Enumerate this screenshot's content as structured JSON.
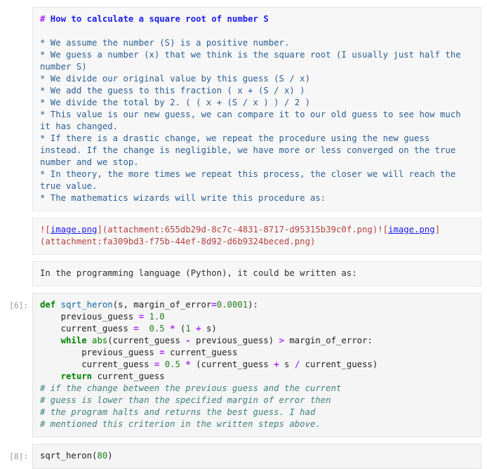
{
  "notebook": {
    "cells": [
      {
        "type": "markdown-source",
        "prompt": "",
        "heading_hash": "#",
        "heading_text": " How to calculate a square root of number S",
        "blank": "",
        "lines": [
          "* We assume the number (S) is a positive number.",
          "* We guess a number (x) that we think is the square root (I usually just half the number S)",
          "* We divide our original value by this guess (S / x)",
          "* We add the guess to this fraction ( x + (S / x) )",
          "* We divide the total by 2. ( ( x + (S / x ) ) / 2 )",
          "* This value is our new guess, we can compare it to our old guess to see how much it has changed.",
          "* If there is a drastic change, we repeat the procedure using the new guess instead. If the change is negligible, we have more or less converged on the true number and we stop.",
          "* In theory, the more times we repeat this process, the closer we will reach the true value.",
          "* The mathematics wizards will write this procedure as:"
        ]
      },
      {
        "type": "markdown-image-links",
        "prompt": "",
        "bang1": "!",
        "lb1": "[",
        "link1": "image.png",
        "rb1": "]",
        "target1": "(attachment:655db29d-8c7c-4831-8717-d95315b39c0f.png)",
        "bang2": "!",
        "lb2": "[",
        "link2": "image.png",
        "rb2": "]",
        "target2": "(attachment:fa309bd3-f75b-44ef-8d92-d6b9324beced.png)"
      },
      {
        "type": "markdown-text",
        "prompt": "",
        "text": "In the programming language (Python), it could be written as:"
      },
      {
        "type": "code",
        "prompt": "[6]:",
        "code_lines": [
          {
            "indent": "",
            "tokens": [
              {
                "t": "def ",
                "c": "kw"
              },
              {
                "t": "sqrt_heron",
                "c": "fn"
              },
              {
                "t": "(s, margin_of_error",
                "c": "code"
              },
              {
                "t": "=",
                "c": "op"
              },
              {
                "t": "0.0001",
                "c": "num"
              },
              {
                "t": "):",
                "c": "code"
              }
            ]
          },
          {
            "indent": "    ",
            "tokens": [
              {
                "t": "previous_guess ",
                "c": "code"
              },
              {
                "t": "=",
                "c": "op"
              },
              {
                "t": " ",
                "c": "code"
              },
              {
                "t": "1.0",
                "c": "num"
              }
            ]
          },
          {
            "indent": "    ",
            "tokens": [
              {
                "t": "current_guess ",
                "c": "code"
              },
              {
                "t": "=",
                "c": "op"
              },
              {
                "t": "  ",
                "c": "code"
              },
              {
                "t": "0.5",
                "c": "num"
              },
              {
                "t": " ",
                "c": "code"
              },
              {
                "t": "*",
                "c": "op"
              },
              {
                "t": " (",
                "c": "code"
              },
              {
                "t": "1",
                "c": "num"
              },
              {
                "t": " ",
                "c": "code"
              },
              {
                "t": "+",
                "c": "op"
              },
              {
                "t": " s)",
                "c": "code"
              }
            ]
          },
          {
            "indent": "    ",
            "tokens": [
              {
                "t": "while ",
                "c": "kw"
              },
              {
                "t": "abs",
                "c": "builtin"
              },
              {
                "t": "(current_guess ",
                "c": "code"
              },
              {
                "t": "-",
                "c": "op"
              },
              {
                "t": " previous_guess) ",
                "c": "code"
              },
              {
                "t": ">",
                "c": "op"
              },
              {
                "t": " margin_of_error:",
                "c": "code"
              }
            ]
          },
          {
            "indent": "        ",
            "tokens": [
              {
                "t": "previous_guess ",
                "c": "code"
              },
              {
                "t": "=",
                "c": "op"
              },
              {
                "t": " current_guess",
                "c": "code"
              }
            ]
          },
          {
            "indent": "        ",
            "tokens": [
              {
                "t": "current_guess ",
                "c": "code"
              },
              {
                "t": "=",
                "c": "op"
              },
              {
                "t": " ",
                "c": "code"
              },
              {
                "t": "0.5",
                "c": "num"
              },
              {
                "t": " ",
                "c": "code"
              },
              {
                "t": "*",
                "c": "op"
              },
              {
                "t": " (current_guess ",
                "c": "code"
              },
              {
                "t": "+",
                "c": "op"
              },
              {
                "t": " s ",
                "c": "code"
              },
              {
                "t": "/",
                "c": "op"
              },
              {
                "t": " current_guess)",
                "c": "code"
              }
            ]
          },
          {
            "indent": "    ",
            "tokens": [
              {
                "t": "return ",
                "c": "kw"
              },
              {
                "t": "current_guess",
                "c": "code"
              }
            ]
          },
          {
            "indent": "",
            "tokens": [
              {
                "t": "# if the change between the previous guess and the current",
                "c": "cmt"
              }
            ]
          },
          {
            "indent": "",
            "tokens": [
              {
                "t": "# guess is lower than the specified margin of error then",
                "c": "cmt"
              }
            ]
          },
          {
            "indent": "",
            "tokens": [
              {
                "t": "# the program halts and returns the best guess. I had",
                "c": "cmt"
              }
            ]
          },
          {
            "indent": "",
            "tokens": [
              {
                "t": "# mentioned this criterion in the written steps above.",
                "c": "cmt"
              }
            ]
          }
        ]
      },
      {
        "type": "code",
        "prompt": "[8]:",
        "code_lines": [
          {
            "indent": "",
            "tokens": [
              {
                "t": "sqrt_heron",
                "c": "code"
              },
              {
                "t": "(",
                "c": "code"
              },
              {
                "t": "80",
                "c": "num"
              },
              {
                "t": ")",
                "c": "code"
              }
            ]
          }
        ]
      }
    ]
  },
  "colors": {
    "cell_background": "#f5f5f5",
    "cell_border": "#e3e3e3",
    "prompt_text": "#9a9a9a",
    "markdown_source": "#2b5f93",
    "heading": "#1a1aee",
    "heading_hash": "#aa22ff",
    "link": "#1a1aee",
    "link_target": "#b5413f",
    "keyword": "#008000",
    "function_name": "#0f68a0",
    "number": "#207f20",
    "operator": "#aa22ff",
    "comment": "#408080"
  }
}
